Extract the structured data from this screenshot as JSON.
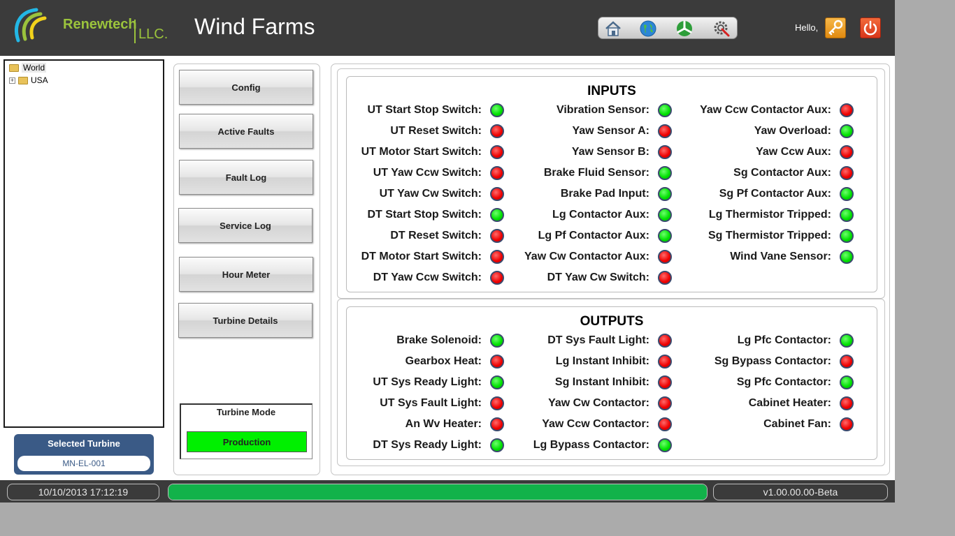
{
  "header": {
    "brand": "Renewtech",
    "brand_suffix": "LLC.",
    "title": "Wind Farms",
    "greeting": "Hello,",
    "nav_icons": [
      "home-icon",
      "globe-icon",
      "wind-turbine-icon",
      "settings-tools-icon"
    ],
    "key_icon": "key-icon",
    "power_icon": "power-icon"
  },
  "tree": {
    "root": "World",
    "child": "USA"
  },
  "selected_turbine": {
    "title": "Selected Turbine",
    "value": "MN-EL-001"
  },
  "menu": {
    "buttons": [
      "Config",
      "Active Faults",
      "Fault Log",
      "Service Log",
      "Hour Meter",
      "Turbine Details"
    ]
  },
  "turbine_mode": {
    "title": "Turbine Mode",
    "value": "Production",
    "color": "#00f000"
  },
  "inputs": {
    "title": "INPUTS",
    "columns": [
      [
        {
          "label": "UT Start Stop Switch:",
          "on": true
        },
        {
          "label": "UT Reset Switch:",
          "on": false
        },
        {
          "label": "UT Motor Start Switch:",
          "on": false
        },
        {
          "label": "UT Yaw Ccw Switch:",
          "on": false
        },
        {
          "label": "UT Yaw Cw Switch:",
          "on": false
        },
        {
          "label": "DT Start Stop Switch:",
          "on": true
        },
        {
          "label": "DT Reset Switch:",
          "on": false
        },
        {
          "label": "DT Motor Start Switch:",
          "on": false
        },
        {
          "label": "DT Yaw Ccw Switch:",
          "on": false
        }
      ],
      [
        {
          "label": "Vibration Sensor:",
          "on": true
        },
        {
          "label": "Yaw Sensor A:",
          "on": false
        },
        {
          "label": "Yaw Sensor B:",
          "on": false
        },
        {
          "label": "Brake Fluid Sensor:",
          "on": true
        },
        {
          "label": "Brake Pad Input:",
          "on": true
        },
        {
          "label": "Lg Contactor Aux:",
          "on": true
        },
        {
          "label": "Lg Pf Contactor Aux:",
          "on": true
        },
        {
          "label": "Yaw Cw Contactor Aux:",
          "on": false
        },
        {
          "label": "DT Yaw Cw Switch:",
          "on": false
        }
      ],
      [
        {
          "label": "Yaw Ccw Contactor Aux:",
          "on": false
        },
        {
          "label": "Yaw Overload:",
          "on": true
        },
        {
          "label": "Yaw Ccw Aux:",
          "on": false
        },
        {
          "label": "Sg Contactor Aux:",
          "on": false
        },
        {
          "label": "Sg Pf Contactor Aux:",
          "on": true
        },
        {
          "label": "Lg Thermistor Tripped:",
          "on": true
        },
        {
          "label": "Sg Thermistor Tripped:",
          "on": true
        },
        {
          "label": "Wind Vane Sensor:",
          "on": true
        }
      ]
    ]
  },
  "outputs": {
    "title": "OUTPUTS",
    "columns": [
      [
        {
          "label": "Brake Solenoid:",
          "on": true
        },
        {
          "label": "Gearbox Heat:",
          "on": false
        },
        {
          "label": "UT Sys Ready Light:",
          "on": true
        },
        {
          "label": "UT Sys Fault Light:",
          "on": false
        },
        {
          "label": "An Wv Heater:",
          "on": false
        },
        {
          "label": "DT Sys Ready Light:",
          "on": true
        }
      ],
      [
        {
          "label": "DT Sys Fault Light:",
          "on": false
        },
        {
          "label": "Lg Instant Inhibit:",
          "on": false
        },
        {
          "label": "Sg Instant Inhibit:",
          "on": false
        },
        {
          "label": "Yaw Cw Contactor:",
          "on": false
        },
        {
          "label": "Yaw Ccw Contactor:",
          "on": false
        },
        {
          "label": "Lg Bypass Contactor:",
          "on": true
        }
      ],
      [
        {
          "label": "Lg Pfc Contactor:",
          "on": true
        },
        {
          "label": "Sg Bypass Contactor:",
          "on": false
        },
        {
          "label": "Sg Pfc Contactor:",
          "on": true
        },
        {
          "label": "Cabinet Heater:",
          "on": false
        },
        {
          "label": "Cabinet Fan:",
          "on": false
        }
      ]
    ]
  },
  "status_bar": {
    "datetime": "10/10/2013 17:12:19",
    "progress_percent": 100,
    "progress_color": "#12b24a",
    "version": "v1.00.00.00-Beta"
  }
}
